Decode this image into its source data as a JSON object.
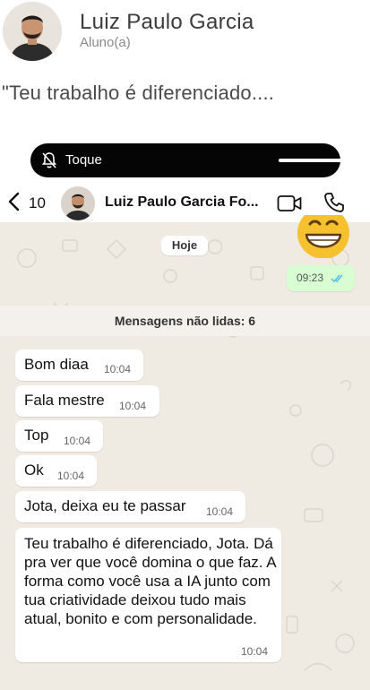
{
  "profile": {
    "name": "Luiz Paulo Garcia",
    "role": "Aluno(a)",
    "quote": "\"Teu trabalho é diferenciado...."
  },
  "screenshot": {
    "status_pill": {
      "label": "Toque"
    },
    "chat_header": {
      "back_count": "10",
      "contact_name": "Luiz Paulo Garcia Fo..."
    },
    "date_chip": "Hoje",
    "outgoing_message": {
      "time": "09:23"
    },
    "unread_banner": "Mensagens não lidas: 6",
    "messages": [
      {
        "text": "Bom diaa",
        "time": "10:04"
      },
      {
        "text": "Fala mestre",
        "time": "10:04"
      },
      {
        "text": "Top",
        "time": "10:04"
      },
      {
        "text": "Ok",
        "time": "10:04"
      },
      {
        "text": "Jota, deixa eu te passar",
        "time": "10:04"
      },
      {
        "text": "Teu trabalho é diferenciado, Jota. Dá pra ver que você domina o que faz. A forma como você usa a IA junto com tua criatividade deixou tudo mais atual, bonito e com personalidade.",
        "time": "10:04"
      }
    ]
  },
  "colors": {
    "wallpaper": "#efeae2",
    "outgoing_bubble": "#d9fdd3",
    "incoming_bubble": "#ffffff",
    "read_ticks": "#53bdeb"
  }
}
